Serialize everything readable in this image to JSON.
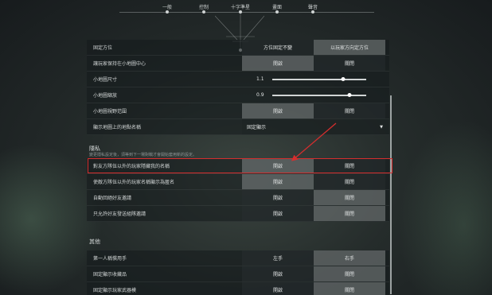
{
  "nav": {
    "tabs": [
      "一般",
      "控制",
      "十字準星",
      "畫面",
      "聲音"
    ]
  },
  "map_rows": [
    {
      "label": "固定方位",
      "type": "options",
      "options": [
        "方位固定不變",
        "以玩家方向定方位"
      ],
      "selected": 1
    },
    {
      "label": "讓玩家保持在小地圖中心",
      "type": "options",
      "options": [
        "開啟",
        "關閉"
      ],
      "selected": 0
    },
    {
      "label": "小地圖尺寸",
      "type": "slider",
      "value": "1.1",
      "fraction": 0.75
    },
    {
      "label": "小地圖縮放",
      "type": "slider",
      "value": "0.9",
      "fraction": 0.82
    },
    {
      "label": "小地圖視野范圍",
      "type": "options",
      "options": [
        "開啟",
        "關閉"
      ],
      "selected": 0
    },
    {
      "label": "顯示地圖上的地點名稱",
      "type": "dropdown",
      "value": "固定顯示"
    }
  ],
  "privacy": {
    "title": "隱私",
    "description": "變更隱私設定後，須等到下一場對戰才會開始套用新的設定。",
    "rows": [
      {
        "label": "對友方隊伍以外的玩家隱藏我的名稱",
        "options": [
          "開啟",
          "關閉"
        ],
        "selected": 0
      },
      {
        "label": "使敵方隊伍以外的玩家名稱顯示為匿名",
        "options": [
          "開啟",
          "關閉"
        ],
        "selected": 0
      },
      {
        "label": "自動回絕好友邀請",
        "options": [
          "開啟",
          "關閉"
        ],
        "selected": 1
      },
      {
        "label": "只允許好友發送組隊邀請",
        "options": [
          "開啟",
          "關閉"
        ],
        "selected": 1
      }
    ]
  },
  "other": {
    "title": "其他",
    "rows": [
      {
        "label": "第一人稱慣用手",
        "options": [
          "左手",
          "右手"
        ],
        "selected": 1
      },
      {
        "label": "固定顯示收藏品",
        "options": [
          "開啟",
          "關閉"
        ],
        "selected": 1
      },
      {
        "label": "固定顯示玩家武器模",
        "options": [
          "開啟",
          "關閉"
        ],
        "selected": 1
      }
    ]
  },
  "colors": {
    "highlight": "#d62e2e",
    "selected_option": "#7f8585"
  }
}
